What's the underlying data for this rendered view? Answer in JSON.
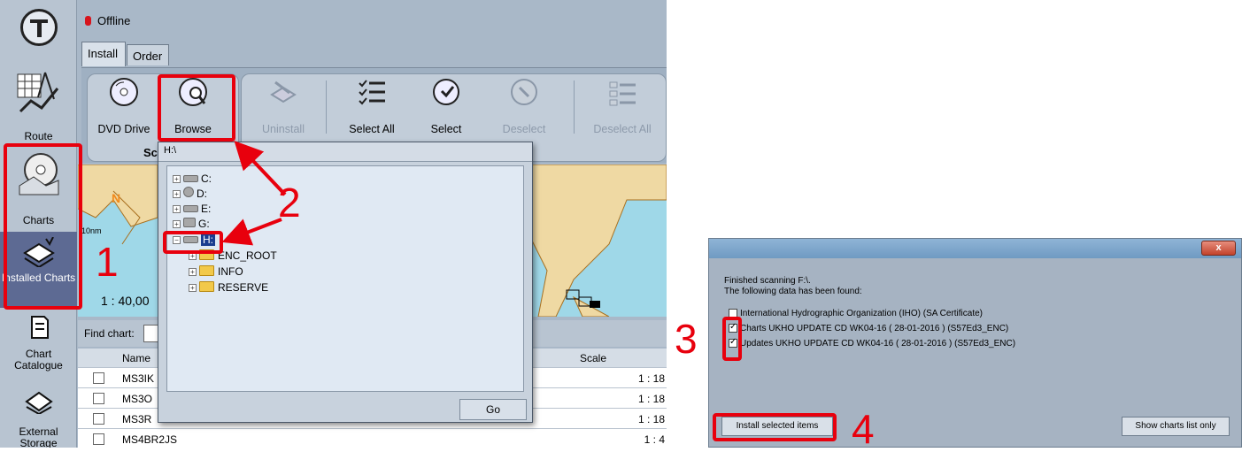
{
  "status": {
    "text": "Offline",
    "color": "#d7141c"
  },
  "nav": [
    {
      "label": "Route",
      "icon": "route-icon"
    },
    {
      "label": "Charts",
      "icon": "charts-disc-icon"
    },
    {
      "label": "Installed Charts",
      "icon": "installed-charts-icon"
    },
    {
      "label": "Chart Catalogue",
      "icon": "chart-catalogue-icon"
    },
    {
      "label": "External Storage",
      "icon": "external-storage-icon"
    }
  ],
  "tabs": [
    "Install",
    "Order"
  ],
  "toolbar": {
    "dvd": "DVD Drive",
    "browse": "Browse",
    "uninstall": "Uninstall",
    "select_all": "Select All",
    "select": "Select",
    "deselect": "Deselect",
    "deselect_all": "Deselect All",
    "sub_label": "Sc"
  },
  "map": {
    "scale_text": "1 : 40,00",
    "scale_bar": "10nm",
    "north": "N"
  },
  "find": {
    "label": "Find chart:",
    "value": ""
  },
  "table": {
    "headers": {
      "name": "Name",
      "scale": "Scale"
    },
    "rows": [
      {
        "name": "MS3IK",
        "scale": "1 : 18"
      },
      {
        "name": "MS3O",
        "scale": "1 : 18"
      },
      {
        "name": "MS3R",
        "scale": "1 : 18"
      },
      {
        "name": "MS4BR2JS",
        "scale": "1 : 4"
      }
    ]
  },
  "browse": {
    "path": "H:\\",
    "drives": [
      "C:",
      "D:",
      "E:",
      "G:",
      "H:"
    ],
    "folders": [
      "ENC_ROOT",
      "INFO",
      "RESERVE"
    ],
    "go": "Go"
  },
  "dialog": {
    "line1": "Finished scanning F:\\.",
    "line2": "The following data has been found:",
    "items": [
      {
        "label": "International Hydrographic Organization (IHO) (SA Certificate)",
        "checked": false
      },
      {
        "label": "Charts UKHO UPDATE CD WK04-16    ( 28-01-2016 ) (S57Ed3_ENC)",
        "checked": true
      },
      {
        "label": "Updates UKHO UPDATE CD WK04-16    ( 28-01-2016 ) (S57Ed3_ENC)",
        "checked": true
      }
    ],
    "install_btn": "Install selected items",
    "show_btn": "Show charts list only",
    "close": "x"
  },
  "annotations": {
    "n1": "1",
    "n2": "2",
    "n3": "3",
    "n4": "4",
    "color": "#e8000d"
  }
}
